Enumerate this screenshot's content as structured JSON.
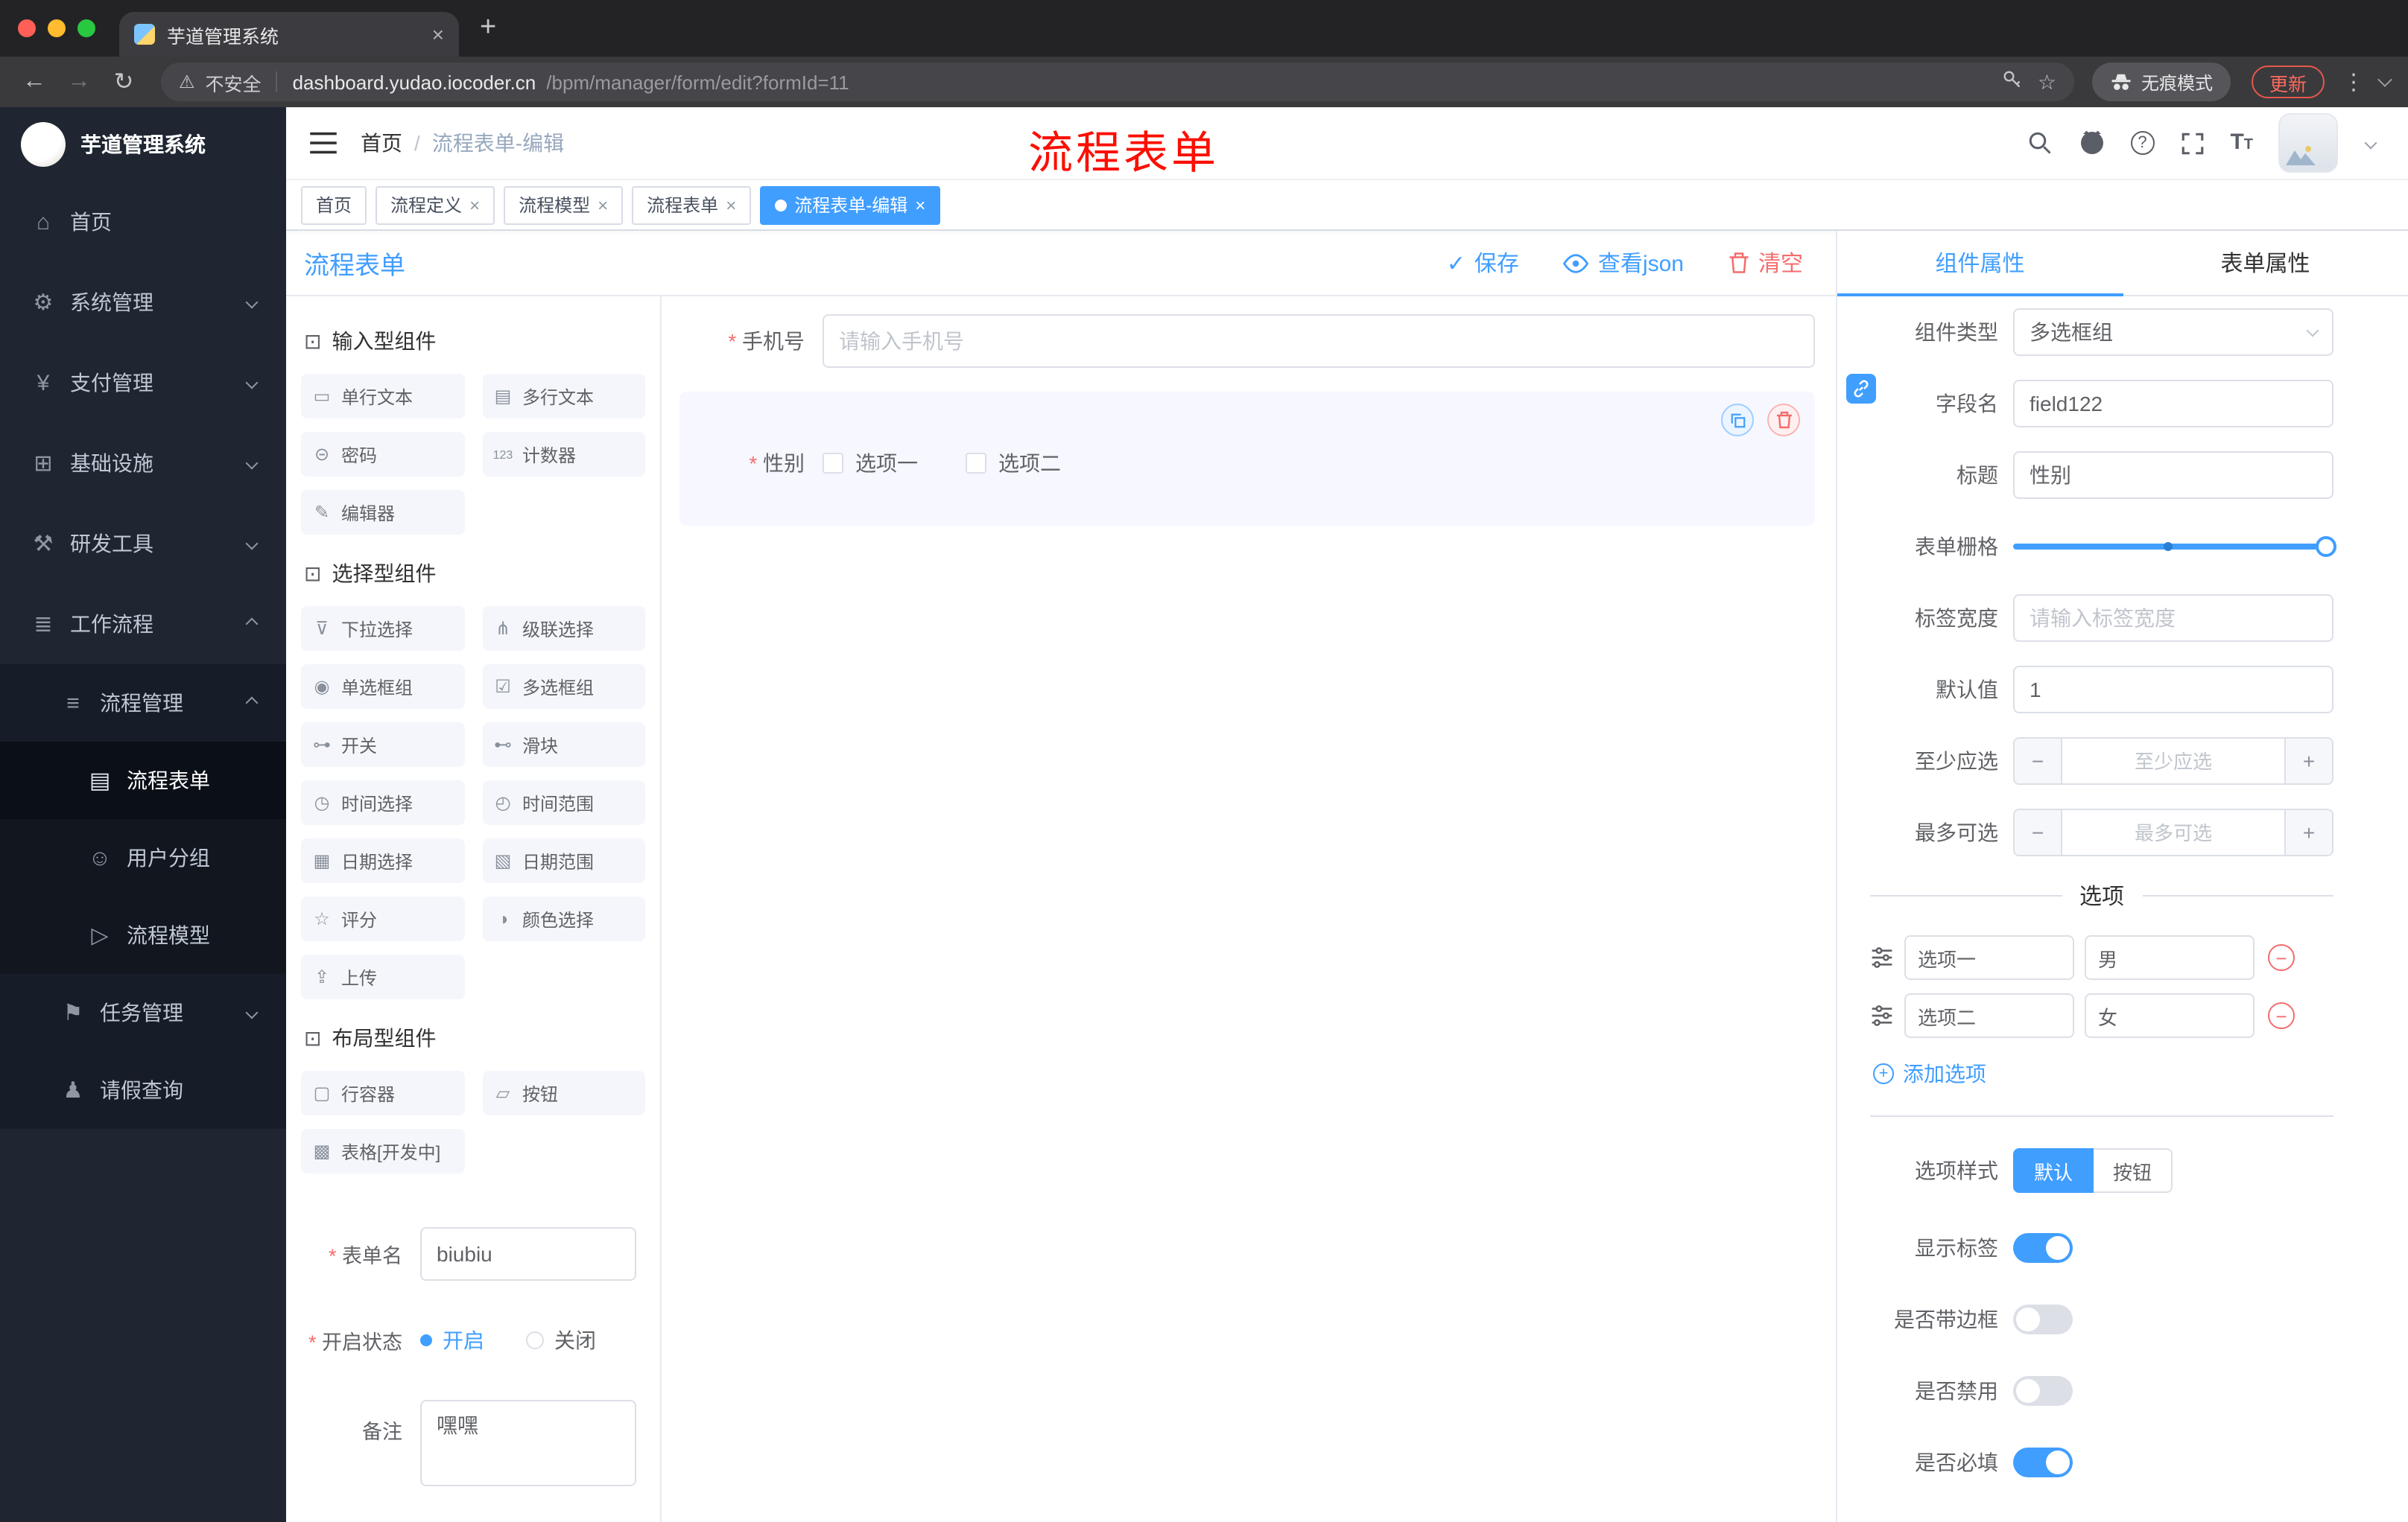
{
  "colors": {
    "accent": "#409eff",
    "danger": "#f56c6c",
    "sidebar_bg": "#1f2632",
    "selected_bg": "#f6f7ff"
  },
  "browser": {
    "tab_title": "芋道管理系统",
    "security_label": "不安全",
    "url_host": "dashboard.yudao.iocoder.cn",
    "url_path": "/bpm/manager/form/edit?formId=11",
    "incognito_label": "无痕模式",
    "update_label": "更新"
  },
  "sidebar": {
    "logo_title": "芋道管理系统",
    "items": [
      {
        "label": "首页"
      },
      {
        "label": "系统管理"
      },
      {
        "label": "支付管理"
      },
      {
        "label": "基础设施"
      },
      {
        "label": "研发工具"
      },
      {
        "label": "工作流程"
      },
      {
        "label": "流程管理"
      },
      {
        "label": "流程表单"
      },
      {
        "label": "用户分组"
      },
      {
        "label": "流程模型"
      },
      {
        "label": "任务管理"
      },
      {
        "label": "请假查询"
      }
    ]
  },
  "navbar": {
    "breadcrumb_home": "首页",
    "breadcrumb_sep": "/",
    "breadcrumb_current": "流程表单-编辑",
    "overlay_title": "流程表单"
  },
  "tags": [
    {
      "label": "首页"
    },
    {
      "label": "流程定义",
      "close": "×"
    },
    {
      "label": "流程模型",
      "close": "×"
    },
    {
      "label": "流程表单",
      "close": "×"
    },
    {
      "label": "流程表单-编辑",
      "close": "×"
    }
  ],
  "designer": {
    "title": "流程表单",
    "save": "保存",
    "view_json": "查看json",
    "clear": "清空",
    "groups": [
      {
        "title": "输入型组件",
        "items": [
          "单行文本",
          "多行文本",
          "密码",
          "计数器",
          "编辑器"
        ]
      },
      {
        "title": "选择型组件",
        "items": [
          "下拉选择",
          "级联选择",
          "单选框组",
          "多选框组",
          "开关",
          "滑块",
          "时间选择",
          "时间范围",
          "日期选择",
          "日期范围",
          "评分",
          "颜色选择",
          "上传"
        ]
      },
      {
        "title": "布局型组件",
        "items": [
          "行容器",
          "按钮",
          "表格[开发中]"
        ]
      }
    ],
    "meta": {
      "name_label": "表单名",
      "name_value": "biubiu",
      "status_label": "开启状态",
      "status_on": "开启",
      "status_off": "关闭",
      "remark_label": "备注",
      "remark_value": "嘿嘿"
    },
    "canvas": {
      "phone_label": "手机号",
      "phone_placeholder": "请输入手机号",
      "gender_label": "性别",
      "gender_opt1": "选项一",
      "gender_opt2": "选项二"
    }
  },
  "props": {
    "tab_component": "组件属性",
    "tab_form": "表单属性",
    "rows": {
      "type_label": "组件类型",
      "type_value": "多选框组",
      "field_label": "字段名",
      "field_value": "field122",
      "title_label": "标题",
      "title_value": "性别",
      "grid_label": "表单栅格",
      "width_label": "标签宽度",
      "width_placeholder": "请输入标签宽度",
      "default_label": "默认值",
      "default_value": "1",
      "min_label": "至少应选",
      "min_placeholder": "至少应选",
      "max_label": "最多可选",
      "max_placeholder": "最多可选"
    },
    "options": {
      "title": "选项",
      "items": [
        {
          "label": "选项一",
          "value": "男"
        },
        {
          "label": "选项二",
          "value": "女"
        }
      ],
      "add": "添加选项"
    },
    "style": {
      "label": "选项样式",
      "opt_default": "默认",
      "opt_button": "按钮",
      "toggle_show_label": "显示标签",
      "toggle_border": "是否带边框",
      "toggle_disabled": "是否禁用",
      "toggle_required": "是否必填"
    }
  }
}
